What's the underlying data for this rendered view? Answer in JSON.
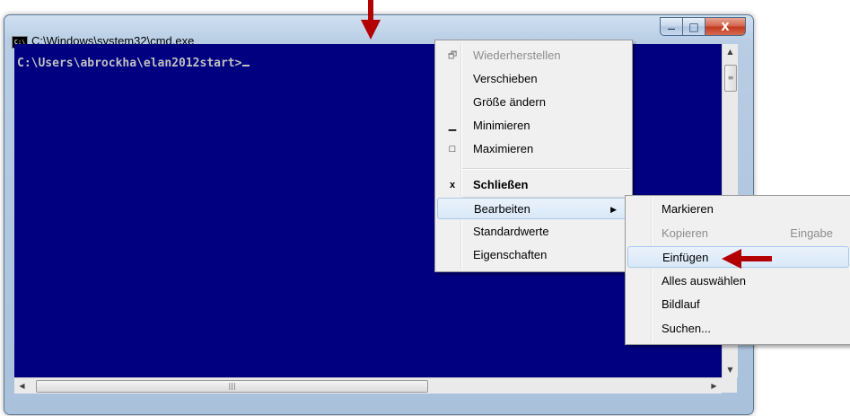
{
  "window": {
    "title": "C:\\Windows\\system32\\cmd.exe",
    "icon_text": "C:\\",
    "controls": {
      "minimize": "—",
      "maximize": "□",
      "close": "X"
    }
  },
  "console": {
    "prompt": "C:\\Users\\abrockha\\elan2012start>"
  },
  "system_menu": {
    "items": [
      {
        "label": "Wiederherstellen",
        "icon": "restore-icon",
        "glyph": "🗗",
        "enabled": false
      },
      {
        "label": "Verschieben",
        "icon": "",
        "glyph": "",
        "enabled": true
      },
      {
        "label": "Größe ändern",
        "icon": "",
        "glyph": "",
        "enabled": true
      },
      {
        "label": "Minimieren",
        "icon": "minimize-icon",
        "glyph": "▁",
        "enabled": true
      },
      {
        "label": "Maximieren",
        "icon": "maximize-icon",
        "glyph": "□",
        "enabled": true
      },
      {
        "label": "Schließen",
        "icon": "close-icon",
        "glyph": "x",
        "enabled": true,
        "bold": true
      },
      {
        "label": "Bearbeiten",
        "icon": "",
        "glyph": "",
        "enabled": true,
        "submenu": true,
        "highlighted": true
      },
      {
        "label": "Standardwerte",
        "icon": "",
        "glyph": "",
        "enabled": true
      },
      {
        "label": "Eigenschaften",
        "icon": "",
        "glyph": "",
        "enabled": true
      }
    ]
  },
  "edit_submenu": {
    "items": [
      {
        "label": "Markieren",
        "shortcut": "",
        "enabled": true
      },
      {
        "label": "Kopieren",
        "shortcut": "Eingabe",
        "enabled": false
      },
      {
        "label": "Einfügen",
        "shortcut": "",
        "enabled": true,
        "highlighted": true
      },
      {
        "label": "Alles auswählen",
        "shortcut": "",
        "enabled": true
      },
      {
        "label": "Bildlauf",
        "shortcut": "",
        "enabled": true
      },
      {
        "label": "Suchen...",
        "shortcut": "",
        "enabled": true
      }
    ]
  },
  "scrollbars": {
    "thumb_grip": "|||",
    "thumb_grip_v": "≡"
  },
  "colors": {
    "console_bg": "#000080",
    "console_text": "#c0c0c0",
    "annotation_arrow": "#b30000"
  }
}
